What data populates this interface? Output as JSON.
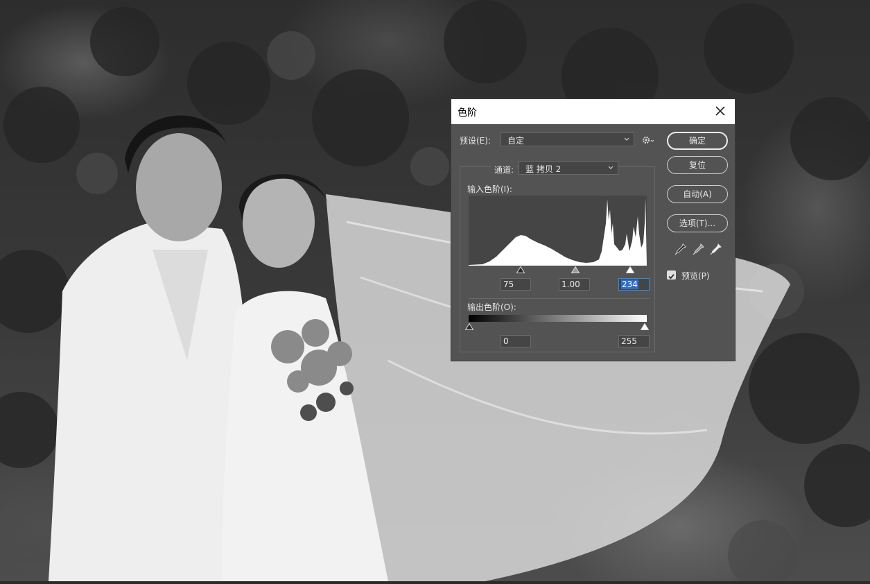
{
  "dialog": {
    "title": "色阶",
    "preset_label": "预设(E):",
    "preset_value": "自定",
    "channel_label": "通道:",
    "channel_value": "蓝 拷贝 2",
    "input_levels_label": "输入色阶(I):",
    "input_black": "75",
    "input_gamma": "1.00",
    "input_white": "234",
    "output_levels_label": "输出色阶(O):",
    "output_black": "0",
    "output_white": "255",
    "buttons": {
      "ok": "确定",
      "reset": "复位",
      "auto": "自动(A)",
      "options": "选项(T)..."
    },
    "preview_label": "预览(P)",
    "preview_checked": true,
    "icons": {
      "close": "close-icon",
      "gear": "gear-icon",
      "black_eyedropper": "black-point-eyedropper-icon",
      "gray_eyedropper": "gray-point-eyedropper-icon",
      "white_eyedropper": "white-point-eyedropper-icon"
    }
  },
  "colors": {
    "dialog_bg": "#535353",
    "field_bg": "#454545",
    "selection": "#2f6dc9"
  }
}
